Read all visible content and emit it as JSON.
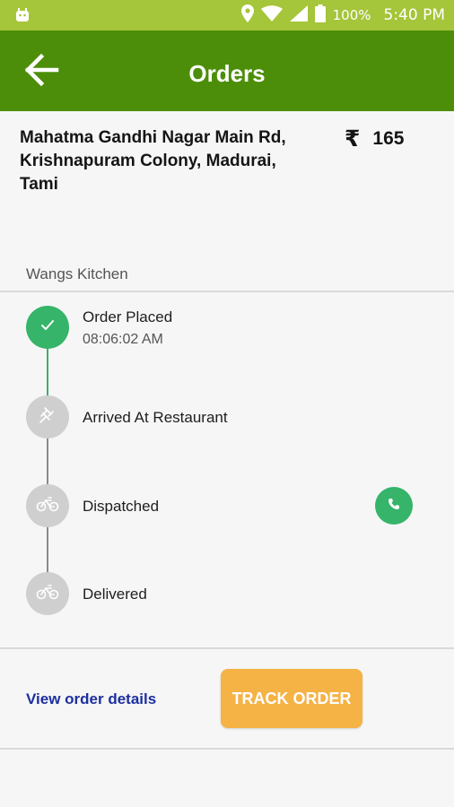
{
  "status_bar": {
    "battery": "100%",
    "time": "5:40 PM",
    "icons": [
      "android-icon",
      "location-icon",
      "wifi-icon",
      "signal-icon",
      "battery-icon"
    ]
  },
  "header": {
    "title": "Orders",
    "back_icon": "arrow-left-icon"
  },
  "order": {
    "address": "Mahatma Gandhi Nagar Main Rd, Krishnapuram Colony, Madurai, Tami",
    "currency_symbol": "₹",
    "amount": "165",
    "restaurant": "Wangs Kitchen"
  },
  "timeline": {
    "steps": [
      {
        "label": "Order Placed",
        "time": "08:06:02 AM",
        "status": "done",
        "icon": "check-icon"
      },
      {
        "label": "Arrived At Restaurant",
        "status": "pending",
        "icon": "pin-icon"
      },
      {
        "label": "Dispatched",
        "status": "pending",
        "icon": "bicycle-icon"
      },
      {
        "label": "Delivered",
        "status": "pending",
        "icon": "bicycle-icon"
      }
    ],
    "call_icon": "phone-icon"
  },
  "footer": {
    "view_details": "View order details",
    "track_order": "TRACK ORDER"
  },
  "colors": {
    "status_bar": "#a5c53a",
    "app_bar": "#4c8e0a",
    "done": "#35b46a",
    "pending": "#cfcfcf",
    "link": "#1c2f9e",
    "track_button": "#f5b245"
  }
}
